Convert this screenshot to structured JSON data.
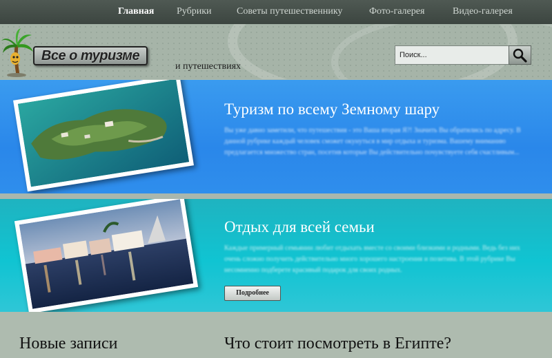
{
  "nav": {
    "items": [
      {
        "label": "Главная",
        "active": true
      },
      {
        "label": "Рубрики",
        "active": false
      },
      {
        "label": "Советы путешественнику",
        "active": false
      },
      {
        "label": "Фото-галерея",
        "active": false
      },
      {
        "label": "Видео-галерея",
        "active": false
      }
    ]
  },
  "header": {
    "logo_text": "Все о туризме",
    "tagline": "и путешествиях",
    "search_placeholder": "Поиск...",
    "search_icon": "magnifier-icon"
  },
  "banners": [
    {
      "title": "Туризм по всему Земному шару",
      "text": "Вы уже давно заметили, что путешествия - это Ваша вторая Я?! Значить Вы обратились по адресу. В данной рубрике каждый человек сможет окунуться в мир отдыха и туризма. Вашему вниманию предлагается множество стран, посетив которые Вы действительно почувствуете себя счастливым..."
    },
    {
      "title": "Отдых для всей семьи",
      "text": "Каждые примерный семьянин любит отдыхать вместе со своими близкими и родными. Ведь без них очень сложно получить действительно много хорошего настроения и позитива. В этой рубрике Вы несомненно подберете красивый подарок для своих родных.",
      "button_label": "Подробнее"
    }
  ],
  "sections": {
    "left_title": "Новые записи",
    "right_title": "Что стоит посмотреть в Египте?"
  },
  "colors": {
    "nav_bg": "#434c47",
    "banner1": "#2f8eec",
    "banner2": "#10c4d2",
    "page_bg": "#aebbaf"
  }
}
